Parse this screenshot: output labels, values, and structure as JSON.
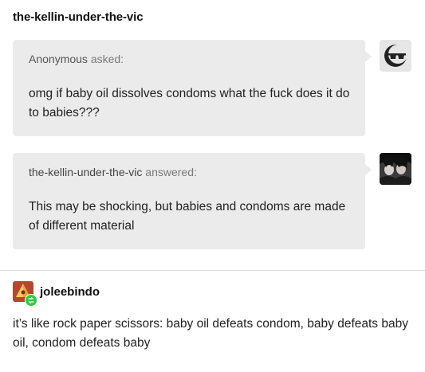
{
  "post": {
    "blog_name": "the-kellin-under-the-vic"
  },
  "ask": {
    "asker_name": "Anonymous",
    "verb": "asked:",
    "question": "omg if baby oil dissolves condoms what the fuck does it do to babies???",
    "avatar_icon": "anonymous-sunglasses-icon"
  },
  "answer": {
    "answerer_name": "the-kellin-under-the-vic",
    "verb": "answered:",
    "text": "This may be shocking, but babies and condoms are made of different material",
    "avatar_icon": "user-photo-avatar"
  },
  "reblog": {
    "blog_name": "joleebindo",
    "avatar_icon": "reblog-avatar-icon",
    "badge_icon": "reblog-icon",
    "text": "it’s like rock paper scissors: baby oil defeats condom, baby defeats baby oil, condom defeats baby"
  },
  "colors": {
    "bubble": "#ebebeb",
    "divider": "#dcdcdc",
    "reblog_badge": "#2ecc40"
  }
}
